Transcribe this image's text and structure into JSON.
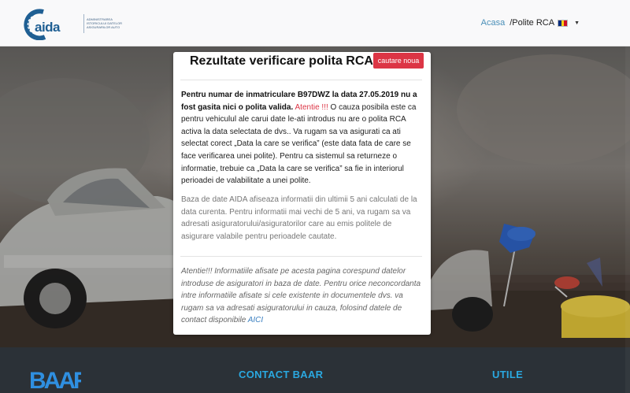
{
  "header": {
    "logo_word": "aida",
    "logo_tagline": "Administrarea istoricului datelor asigurarilor auto",
    "nav_home": "Acasa",
    "nav_current": "/Polite RCA",
    "flag_colors": [
      "#002b7f",
      "#fcd116",
      "#ce1126"
    ]
  },
  "card": {
    "title": "Rezultate verificare polita RCA",
    "new_search_button": "cautare noua",
    "result_bold": "Pentru numar de inmatriculare B97DWZ la data 27.05.2019 nu a fost gasita nici o polita valida.",
    "attention_label": "Atentie !!!",
    "result_text": " O cauza posibila este ca pentru vehiculul ale carui date le-ati introdus nu are o polita RCA activa la data selectata de dvs.. Va rugam sa va asigurati ca ati selectat corect „Data la care se verifica” (este data fata de care se face verificarea unei polite). Pentru ca sistemul sa returneze o informatie, trebuie ca „Data la care se verifica” sa fie in interiorul perioadei de valabilitate a unei polite.",
    "database_info": "Baza de date AIDA afiseaza informatii din ultimii 5 ani calculati de la data curenta. Pentru informatii mai vechi de 5 ani, va rugam sa va adresati asiguratorului/asiguratorilor care au emis politele de asigurare valabile pentru perioadele cautate.",
    "disclaimer": "Atentie!!! Informatiile afisate pe acesta pagina corespund datelor introduse de asiguratori in baza de date. Pentru orice neconcordanta intre informatiile afisate si cele existente in documentele dvs. va rugam sa va adresati asiguratorului in cauza, folosind datele de contact disponibile ",
    "disclaimer_link": "AICI"
  },
  "footer": {
    "logo_text": "BAAR",
    "contact_heading": "CONTACT BAAR",
    "useful_heading": "UTILE"
  },
  "colors": {
    "accent_red": "#dc3545",
    "link_blue": "#3a7fc0",
    "footer_heading": "#2aa8e0",
    "footer_bg": "#2b3137"
  }
}
